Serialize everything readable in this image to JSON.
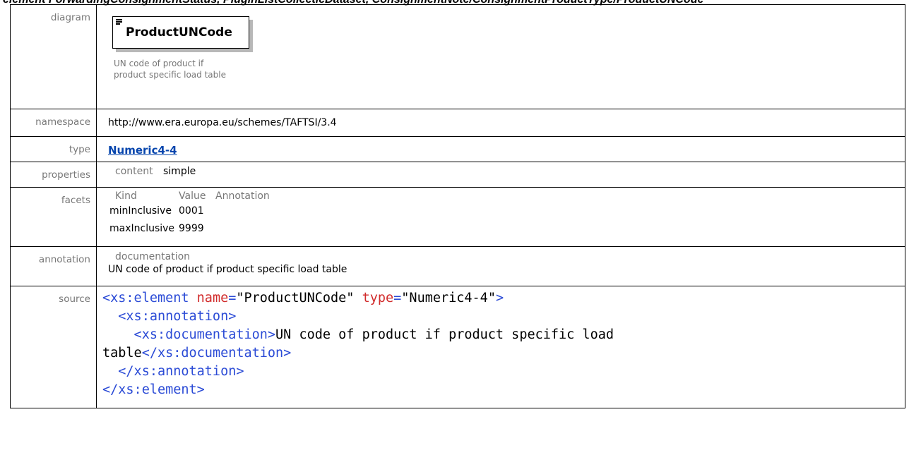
{
  "header": {
    "fragment": "element ForwardingConsignmentStatus, PluginListCollecticDataset, ConsignmentNote/ConsignmentProductType/ProductUNCode"
  },
  "labels": {
    "diagram": "diagram",
    "namespace": "namespace",
    "type": "type",
    "properties": "properties",
    "facets": "facets",
    "annotation": "annotation",
    "source": "source"
  },
  "diagram": {
    "element_name": "ProductUNCode",
    "doc_line1": "UN code of product if",
    "doc_line2": "product specific load table"
  },
  "namespace": "http://www.era.europa.eu/schemes/TAFTSI/3.4",
  "type": "Numeric4-4",
  "properties": {
    "key": "content",
    "value": "simple"
  },
  "facets": {
    "headers": [
      "Kind",
      "Value",
      "Annotation"
    ],
    "rows": [
      {
        "kind": "minInclusive",
        "value": "0001"
      },
      {
        "kind": "maxInclusive",
        "value": "9999"
      }
    ]
  },
  "annotation": {
    "key": "documentation",
    "text": "UN code of product if product specific load table"
  },
  "source": {
    "l1_open": "<xs:element",
    "l1_attr1": " name",
    "l1_eq1": "=",
    "l1_val1": "\"ProductUNCode\"",
    "l1_attr2": " type",
    "l1_eq2": "=",
    "l1_val2": "\"Numeric4-4\"",
    "l1_close": ">",
    "l2": "  <xs:annotation>",
    "l3_tag": "    <xs:documentation>",
    "l3_text": "UN code of product if product specific load",
    "l4_text": "table",
    "l4_tag": "</xs:documentation>",
    "l5": "  </xs:annotation>",
    "l6": "</xs:element>"
  }
}
